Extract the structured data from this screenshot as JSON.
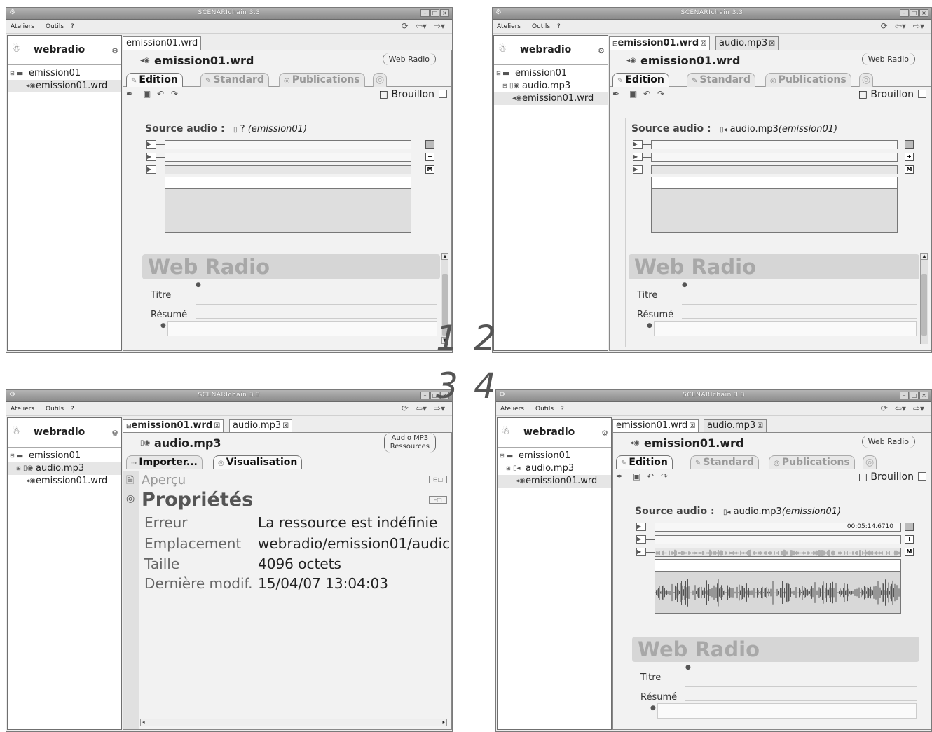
{
  "app": {
    "title": "SCENARIchain 3.3",
    "menu": [
      "Ateliers",
      "Outils",
      "?"
    ]
  },
  "workspace": {
    "name": "webradio"
  },
  "step_labels": [
    "1",
    "2",
    "3",
    "4"
  ],
  "window1": {
    "tree": [
      "emission01",
      "emission01.wrd"
    ],
    "tabs": [
      "emission01.wrd"
    ],
    "doc_name": "emission01.wrd",
    "badge": "Web Radio",
    "view_tabs": [
      "Edition",
      "Standard",
      "Publications"
    ],
    "status": "Brouillon",
    "source_label": "Source audio :",
    "source_value": "?",
    "source_context": "(emission01)",
    "section_title": "Web Radio",
    "fields": [
      "Titre",
      "Résumé"
    ]
  },
  "window2": {
    "tree": [
      "emission01",
      "audio.mp3",
      "emission01.wrd"
    ],
    "tabs": [
      "emission01.wrd",
      "audio.mp3"
    ],
    "doc_name": "emission01.wrd",
    "badge": "Web Radio",
    "view_tabs": [
      "Edition",
      "Standard",
      "Publications"
    ],
    "status": "Brouillon",
    "source_label": "Source audio :",
    "source_value": "audio.mp3",
    "source_context": "(emission01)",
    "section_title": "Web Radio",
    "fields": [
      "Titre",
      "Résumé"
    ]
  },
  "window3": {
    "tree": [
      "emission01",
      "audio.mp3",
      "emission01.wrd"
    ],
    "tabs": [
      "emission01.wrd",
      "audio.mp3"
    ],
    "doc_name": "audio.mp3",
    "badge_line1": "Audio MP3",
    "badge_line2": "Ressources",
    "view_tabs": [
      "Importer...",
      "Visualisation"
    ],
    "apercu": "Aperçu",
    "proprietes": "Propriétés",
    "properties": [
      {
        "key": "Erreur",
        "value": "La ressource est indéfinie"
      },
      {
        "key": "Emplacement",
        "value": "webradio/emission01/audic"
      },
      {
        "key": "Taille",
        "value": "4096 octets"
      },
      {
        "key": "Dernière modif.",
        "value": "15/04/07 13:04:03"
      }
    ]
  },
  "window4": {
    "tree": [
      "emission01",
      "audio.mp3",
      "emission01.wrd"
    ],
    "tabs": [
      "emission01.wrd",
      "audio.mp3"
    ],
    "doc_name": "emission01.wrd",
    "badge": "Web Radio",
    "view_tabs": [
      "Edition",
      "Standard",
      "Publications"
    ],
    "status": "Brouillon",
    "source_label": "Source audio :",
    "source_value": "audio.mp3",
    "source_context": "(emission01)",
    "timecode": "00:05:14.6710",
    "section_title": "Web Radio",
    "fields": [
      "Titre",
      "Résumé"
    ]
  }
}
